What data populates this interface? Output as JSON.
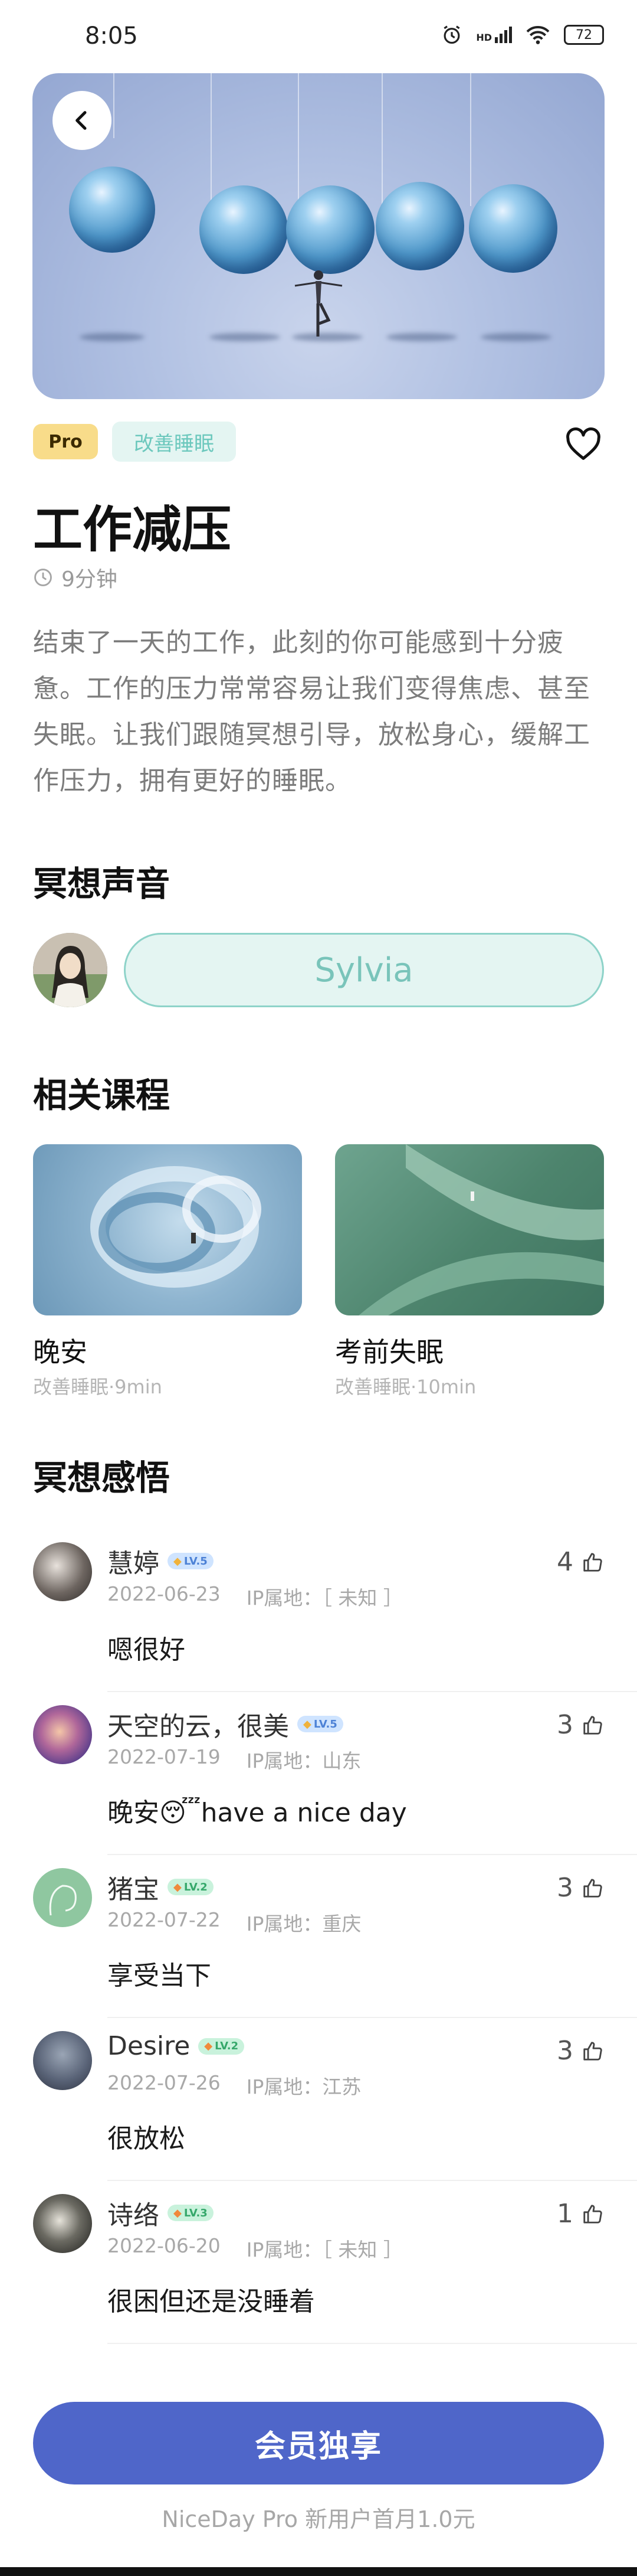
{
  "status_bar": {
    "time": "8:05",
    "alarm_icon": "alarm-icon",
    "signal_label": "HD",
    "wifi_icon": "wifi-icon",
    "battery": "72"
  },
  "hero": {
    "back_icon": "chevron-left-icon"
  },
  "tags": {
    "pro": "Pro",
    "category": "改善睡眠"
  },
  "favorite_icon": "heart-outline-icon",
  "title": "工作减压",
  "duration": "9分钟",
  "description": "结束了一天的工作，此刻的你可能感到十分疲惫。工作的压力常常容易让我们变得焦虑、甚至失眠。让我们跟随冥想引导，放松身心，缓解工作压力，拥有更好的睡眠。",
  "voice_section": {
    "title": "冥想声音",
    "voice_name": "Sylvia"
  },
  "related_section": {
    "title": "相关课程",
    "courses": [
      {
        "name": "晚安",
        "sub": "改善睡眠·9min"
      },
      {
        "name": "考前失眠",
        "sub": "改善睡眠·10min"
      }
    ]
  },
  "comments_section": {
    "title": "冥想感悟",
    "comments": [
      {
        "name": "慧婷",
        "level": "LV.5",
        "date": "2022-06-23",
        "ip": "IP属地：［ 未知 ］",
        "text": "嗯很好",
        "likes": "4"
      },
      {
        "name": "天空的云，很美",
        "level": "LV.5",
        "date": "2022-07-19",
        "ip": "IP属地：山东",
        "text": "晚安😴have a nice day",
        "likes": "3"
      },
      {
        "name": "猪宝",
        "level": "LV.2",
        "date": "2022-07-22",
        "ip": "IP属地：重庆",
        "text": "享受当下",
        "likes": "3"
      },
      {
        "name": "Desire",
        "level": "LV.2",
        "date": "2022-07-26",
        "ip": "IP属地：江苏",
        "text": "很放松",
        "likes": "3"
      },
      {
        "name": "诗络",
        "level": "LV.3",
        "date": "2022-06-20",
        "ip": "IP属地：［ 未知 ］",
        "text": "很困但还是没睡着",
        "likes": "1"
      }
    ]
  },
  "cta": {
    "label": "会员独享",
    "sub": "NiceDay Pro 新用户首月1.0元"
  },
  "colors": {
    "accent": "#4f66c9",
    "teal": "#79c4ba",
    "pro_badge": "#f8dc8a"
  }
}
